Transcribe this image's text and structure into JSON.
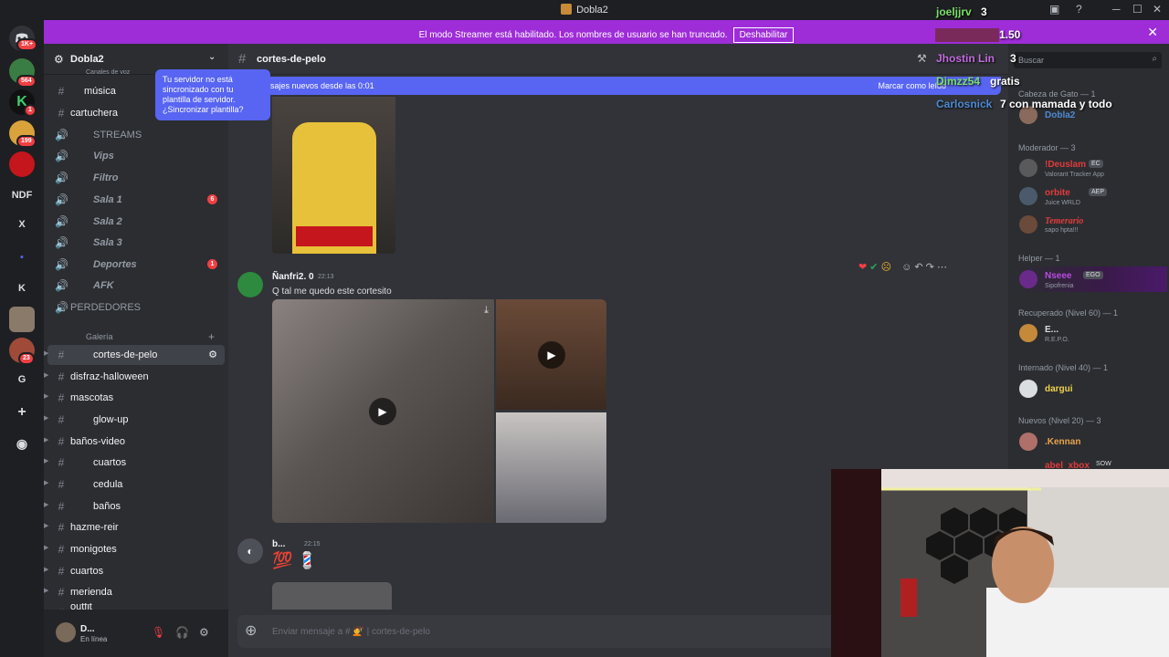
{
  "window": {
    "title": "Dobla2",
    "min": "─",
    "max": "☐",
    "close": "✕"
  },
  "banner": {
    "text": "El modo Streamer está habilitado. Los nombres de usuario se han truncado.",
    "button": "Deshabilitar",
    "close": "✕"
  },
  "rail": {
    "badges": [
      "1K+",
      "564",
      "1",
      "199",
      "23"
    ],
    "labels": [
      "NDF",
      "X",
      "K",
      "G"
    ]
  },
  "sidebar": {
    "server_name": "Dobla2",
    "category_voice": "Canales de voz",
    "tooltip": "Tu servidor no está sincronizado con tu plantilla de servidor. ¿Sincronizar plantilla?",
    "voice": [
      {
        "label": "música",
        "icon": "music"
      },
      {
        "label": "cartuchera",
        "icon": "#"
      },
      {
        "label": "STREAMS",
        "icon": "speaker"
      },
      {
        "label": "Vips",
        "icon": "speaker"
      },
      {
        "label": "Filtro",
        "icon": "speaker"
      },
      {
        "label": "Sala 1",
        "icon": "speaker",
        "badge": "6"
      },
      {
        "label": "Sala 2",
        "icon": "speaker"
      },
      {
        "label": "Sala 3",
        "icon": "speaker"
      },
      {
        "label": "Deportes",
        "icon": "speaker",
        "badge": "1"
      },
      {
        "label": "AFK",
        "icon": "speaker"
      },
      {
        "label": "PERDEDORES",
        "icon": "speaker"
      }
    ],
    "category_gallery": "Galería",
    "text_channels": [
      "cortes-de-pelo",
      "disfraz-halloween",
      "mascotas",
      "glow-up",
      "baños-video",
      "cuartos",
      "cedula",
      "baños",
      "hazme-reir",
      "monigotes",
      "cuartos",
      "merienda",
      "outfit"
    ],
    "last_badge": "1",
    "user": {
      "name": "D...",
      "status": "En línea"
    }
  },
  "chat": {
    "channel": "cortes-de-pelo",
    "new_messages": "sajes nuevos desde las 0:01",
    "mark_read": "Marcar como leído",
    "msg1": {
      "author": "Ñanfri2. 0",
      "time": "22:13",
      "text": "Q tal me quedo este cortesito"
    },
    "msg2": {
      "author": "b...",
      "time": "22:15",
      "text": "💯 💈"
    },
    "placeholder": "Enviar mensaje a # 💇 | cortes-de-pelo"
  },
  "members": {
    "search": "Buscar",
    "groups": [
      {
        "title": "Cabeza de Gato — 1",
        "items": [
          {
            "name": "Dobla2",
            "color": "#4e8ad4"
          }
        ]
      },
      {
        "title": "Moderador — 3",
        "items": [
          {
            "name": "!Deuslam",
            "tag": "EC",
            "sub": "Valorant Tracker App",
            "color": "#e23b3b"
          },
          {
            "name": "orbite",
            "tag": "AEP",
            "sub": "Juice WRLD",
            "color": "#e23b3b"
          },
          {
            "name": "Temerario",
            "sub": "sapo hpta!!!",
            "color": "#e23b3b"
          }
        ]
      },
      {
        "title": "Helper — 1",
        "items": [
          {
            "name": "Nseee",
            "tag": "EGO",
            "sub": "Sipofrenia",
            "color": "#b84be0"
          }
        ]
      },
      {
        "title": "Recuperado (Nivel 60) — 1",
        "items": [
          {
            "name": "E...",
            "sub": "R.E.P.O.",
            "color": "#dbdee1"
          }
        ]
      },
      {
        "title": "Internado (Nivel 40) — 1",
        "items": [
          {
            "name": "dargui",
            "color": "#f0d34a"
          }
        ]
      },
      {
        "title": "Nuevos (Nivel 20) — 3",
        "items": [
          {
            "name": ".Kennan",
            "color": "#e8a34b"
          },
          {
            "name": "abel_xbox",
            "tag": "SOW",
            "color": "#e23b3b"
          }
        ]
      }
    ]
  },
  "overlay": [
    {
      "name": "joeljjrv",
      "value": "3"
    },
    {
      "name": "",
      "value": "1.50"
    },
    {
      "name": "Jhostin Lin",
      "value": "3"
    },
    {
      "name": "Dimzz54",
      "value": "gratis"
    },
    {
      "name": "Carlosnick",
      "value": "7 con mamada y todo"
    }
  ]
}
